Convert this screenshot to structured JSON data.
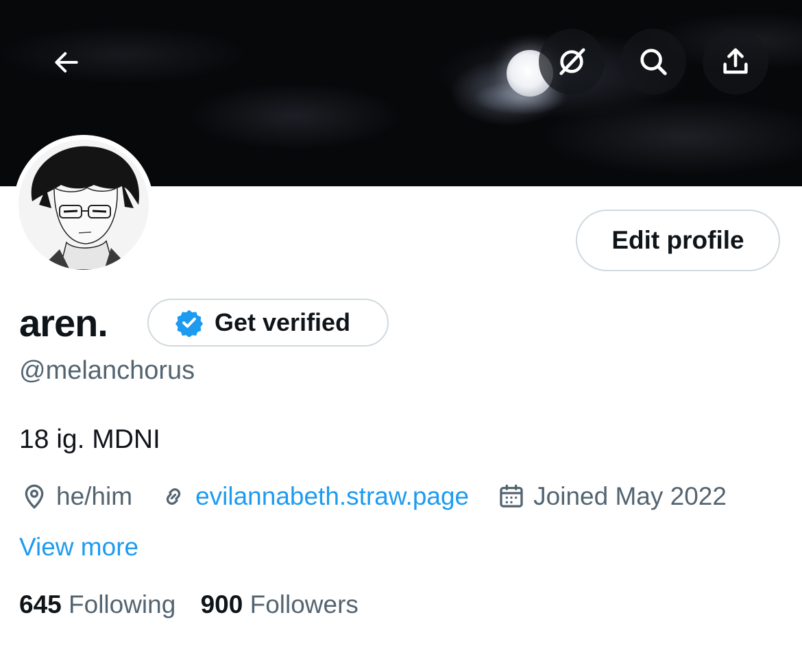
{
  "header": {
    "back_icon": "arrow-left-icon",
    "actions": [
      {
        "icon": "grok-icon"
      },
      {
        "icon": "search-icon"
      },
      {
        "icon": "share-icon"
      }
    ]
  },
  "profile": {
    "display_name": "aren.",
    "verify_label": "Get verified",
    "handle": "@melanchorus",
    "bio": "18 ig. MDNI",
    "pronouns": "he/him",
    "website": "evilannabeth.straw.page",
    "joined": "Joined May 2022",
    "view_more": "View more",
    "edit_profile_label": "Edit profile"
  },
  "stats": {
    "following_count": "645",
    "following_label": "Following",
    "followers_count": "900",
    "followers_label": "Followers"
  },
  "colors": {
    "text_primary": "#0f1419",
    "text_secondary": "#536471",
    "link": "#1d9bf0",
    "button_border": "#cfd9de",
    "verified_badge": "#1d9bf0"
  }
}
